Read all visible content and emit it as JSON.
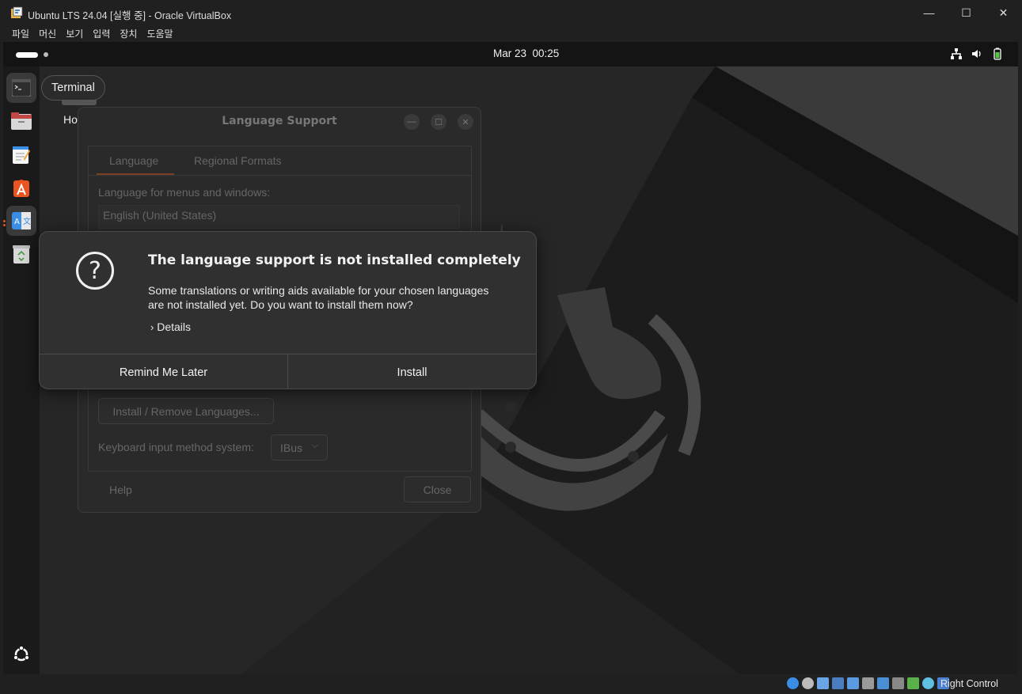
{
  "host_window": {
    "title": "Ubuntu LTS 24.04 [실행 중] - Oracle VirtualBox",
    "controls": {
      "minimize": "—",
      "maximize": "☐",
      "close": "✕"
    },
    "menu": [
      "파일",
      "머신",
      "보기",
      "입력",
      "장치",
      "도움말"
    ]
  },
  "topbar": {
    "clock": "Mar 23  00:25",
    "tray_icons": [
      "network-icon",
      "volume-icon",
      "battery-icon"
    ]
  },
  "dock": {
    "tooltip": "Terminal",
    "items": [
      "terminal-icon",
      "files-icon",
      "text-editor-icon",
      "app-center-icon",
      "language-support-icon",
      "trash-icon"
    ],
    "show_apps_icon": "ubuntu-logo-icon"
  },
  "desktop": {
    "home_label_partial": "Ho"
  },
  "language_window": {
    "title": "Language Support",
    "tabs": [
      "Language",
      "Regional Formats"
    ],
    "section_label": "Language for menus and windows:",
    "languages": [
      "English (United States)"
    ],
    "install_remove_button": "Install / Remove Languages...",
    "keyboard_label": "Keyboard input method system:",
    "keyboard_value": "IBus",
    "help_button": "Help",
    "close_button": "Close"
  },
  "dialog": {
    "title": "The language support is not installed completely",
    "message_line1": "Some translations or writing aids available for your chosen languages",
    "message_line2": "are not installed yet. Do you want to install them now?",
    "details_label": "Details",
    "remind_button": "Remind Me Later",
    "install_button": "Install"
  },
  "statusbar": {
    "host_key": "Right Control"
  },
  "colors": {
    "accent": "#e95420",
    "host_bg": "#202020",
    "dialog_bg": "#303030"
  }
}
